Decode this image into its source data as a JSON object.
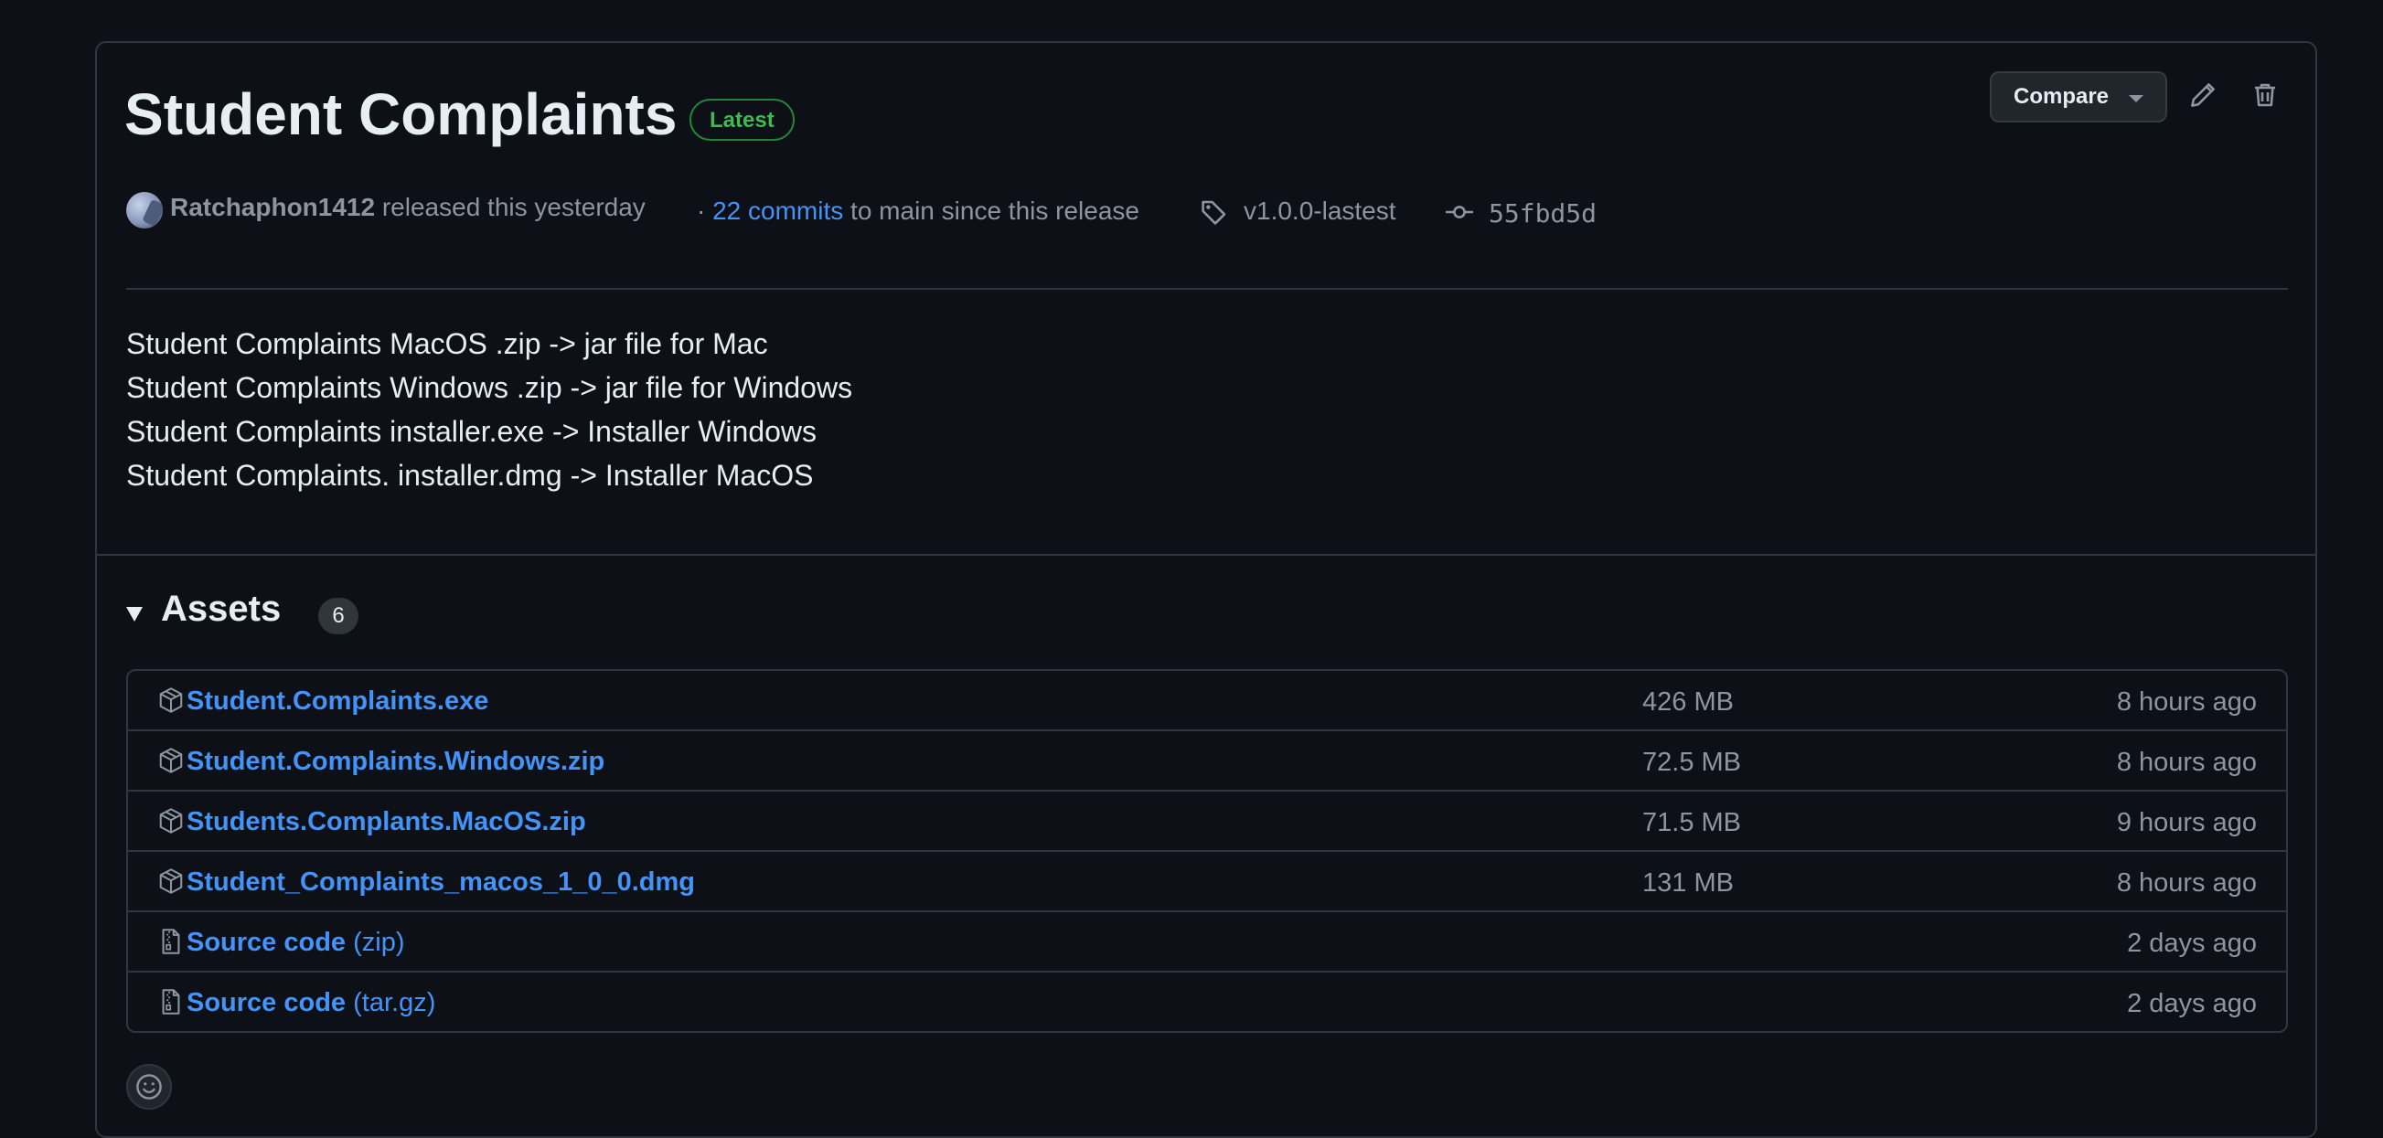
{
  "release": {
    "title": "Student Complaints",
    "badge": "Latest",
    "compare_label": "Compare",
    "author": "Ratchaphon1412",
    "released_text": "released this yesterday",
    "commits_prefix": "·",
    "commits_link": "22 commits",
    "commits_suffix": "to main since this release",
    "tag": "v1.0.0-lastest",
    "commit_sha": "55fbd5d",
    "notes": [
      "Student Complaints MacOS .zip -> jar file for Mac",
      "Student Complaints Windows .zip -> jar file for Windows",
      "Student Complaints installer.exe -> Installer Windows",
      "Student Complaints. installer.dmg -> Installer MacOS"
    ]
  },
  "assets": {
    "title": "Assets",
    "count": "6",
    "items": [
      {
        "name": "Student.Complaints.exe",
        "suffix": "",
        "size": "426 MB",
        "time": "8 hours ago",
        "icon": "package-icon"
      },
      {
        "name": "Student.Complaints.Windows.zip",
        "suffix": "",
        "size": "72.5 MB",
        "time": "8 hours ago",
        "icon": "package-icon"
      },
      {
        "name": "Students.Complants.MacOS.zip",
        "suffix": "",
        "size": "71.5 MB",
        "time": "9 hours ago",
        "icon": "package-icon"
      },
      {
        "name": "Student_Complaints_macos_1_0_0.dmg",
        "suffix": "",
        "size": "131 MB",
        "time": "8 hours ago",
        "icon": "package-icon"
      },
      {
        "name": "Source code",
        "suffix": "(zip)",
        "size": "",
        "time": "2 days ago",
        "icon": "file-zip-icon"
      },
      {
        "name": "Source code",
        "suffix": "(tar.gz)",
        "size": "",
        "time": "2 days ago",
        "icon": "file-zip-icon"
      }
    ]
  },
  "colors": {
    "background": "#0d1117",
    "border": "#30363d",
    "link": "#4493f8",
    "muted": "#8d96a0",
    "badge_green": "#3fb950"
  }
}
